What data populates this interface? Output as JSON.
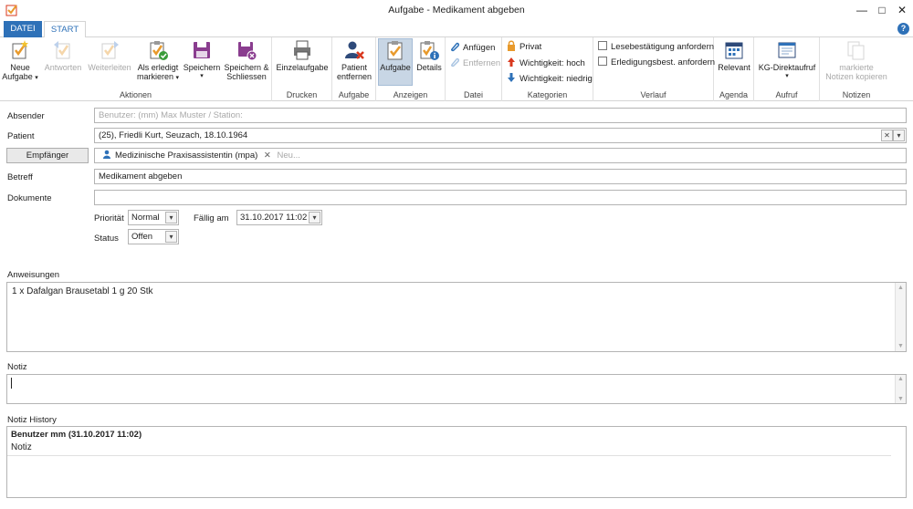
{
  "window": {
    "title": "Aufgabe - Medikament abgeben"
  },
  "tabs": {
    "datei": "DATEI",
    "start": "START",
    "help": "?"
  },
  "ribbon": {
    "aktionen": {
      "label": "Aktionen",
      "neue_aufgabe": "Neue",
      "neue_aufgabe2": "Aufgabe",
      "antworten": "Antworten",
      "weiterleiten": "Weiterleiten",
      "erledigt1": "Als erledigt",
      "erledigt2": "markieren",
      "speichern": "Speichern",
      "speichern_schliessen1": "Speichern &",
      "speichern_schliessen2": "Schliessen"
    },
    "drucken": {
      "label": "Drucken",
      "einzelaufgabe": "Einzelaufgabe"
    },
    "aufgabe": {
      "label": "Aufgabe",
      "patient1": "Patient",
      "patient2": "entfernen"
    },
    "anzeigen": {
      "label": "Anzeigen",
      "aufgabe": "Aufgabe",
      "details": "Details"
    },
    "datei": {
      "label": "Datei",
      "anfuegen": "Anfügen",
      "entfernen": "Entfernen"
    },
    "kategorien": {
      "label": "Kategorien",
      "privat": "Privat",
      "hoch": "Wichtigkeit: hoch",
      "niedrig": "Wichtigkeit: niedrig"
    },
    "verlauf": {
      "label": "Verlauf",
      "lese": "Lesebestätigung anfordern",
      "erledigung": "Erledigungsbest. anfordern"
    },
    "agenda": {
      "label": "Agenda",
      "relevant": "Relevant"
    },
    "aufruf": {
      "label": "Aufruf",
      "kg": "KG-Direktaufruf"
    },
    "notizen": {
      "label": "Notizen",
      "kopieren1": "markierte",
      "kopieren2": "Notizen kopieren"
    }
  },
  "form": {
    "absender_label": "Absender",
    "absender_placeholder": "Benutzer: (mm) Max Muster / Station:",
    "patient_label": "Patient",
    "patient_value": "(25), Friedli Kurt, Seuzach, 18.10.1964",
    "empfaenger_button": "Empfänger",
    "empfaenger_chip": "Medizinische Praxisassistentin (mpa)",
    "empfaenger_new": "Neu...",
    "betreff_label": "Betreff",
    "betreff_value": "Medikament abgeben",
    "dokumente_label": "Dokumente",
    "prioritaet_label": "Priorität",
    "prioritaet_value": "Normal",
    "faellig_label": "Fällig am",
    "faellig_value": "31.10.2017 11:02",
    "status_label": "Status",
    "status_value": "Offen"
  },
  "anweisungen": {
    "label": "Anweisungen",
    "text": "1 x Dafalgan Brausetabl 1 g 20 Stk"
  },
  "notiz": {
    "label": "Notiz",
    "text": ""
  },
  "history": {
    "label": "Notiz History",
    "entry_header": "Benutzer mm (31.10.2017 11:02)",
    "entry_text": "Notiz"
  },
  "colors": {
    "accent": "#2e71b8",
    "active_bg": "#c8d6e5",
    "icon_purple": "#8a3d8f",
    "arrow_red": "#d9381e",
    "arrow_blue": "#2e71b8"
  }
}
